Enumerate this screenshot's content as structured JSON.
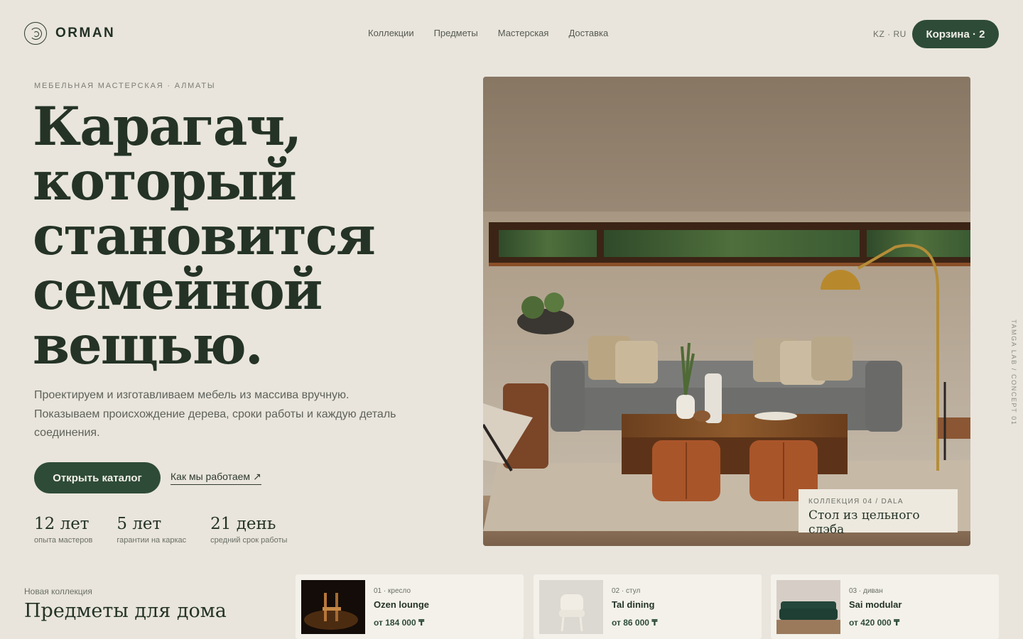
{
  "brand": {
    "name": "ORMAN",
    "logo_icon": "orman-circle-logo"
  },
  "nav": {
    "items": [
      "Коллекции",
      "Предметы",
      "Мастерская",
      "Доставка"
    ]
  },
  "lang": "KZ · RU",
  "cart": {
    "label": "Корзина · 2"
  },
  "hero": {
    "eyebrow": "МЕБЕЛЬНАЯ МАСТЕРСКАЯ · АЛМАТЫ",
    "title_lines": [
      "Карагач,",
      "который",
      "становится",
      "семейной",
      "вещью."
    ],
    "description": "Проектируем и изготавливаем мебель из массива вручную. Показываем происхождение дерева, сроки работы и каждую деталь соединения.",
    "primary_cta": "Открыть каталог",
    "secondary_cta": "Как мы работаем ↗",
    "stats": [
      {
        "value": "12 лет",
        "label": "опыта мастеров"
      },
      {
        "value": "5 лет",
        "label": "гарантии на каркас"
      },
      {
        "value": "21 день",
        "label": "средний срок работы"
      }
    ],
    "image_caption": {
      "small": "КОЛЛЕКЦИЯ 04 / DALA",
      "title": "Стол из цельного слэба"
    }
  },
  "side_text": "TAMGA LAB / CONCEPT 01",
  "collection": {
    "label": "Новая коллекция",
    "title": "Предметы для дома",
    "items": [
      {
        "meta": "01 · кресло",
        "name": "Ozen lounge",
        "price": "от 184 000 ₸"
      },
      {
        "meta": "02 · стул",
        "name": "Tal dining",
        "price": "от 86 000 ₸"
      },
      {
        "meta": "03 · диван",
        "name": "Sai modular",
        "price": "от 420 000 ₸"
      }
    ]
  },
  "colors": {
    "background": "#e9e5dc",
    "accent": "#2e4b38",
    "text": "#243326"
  }
}
